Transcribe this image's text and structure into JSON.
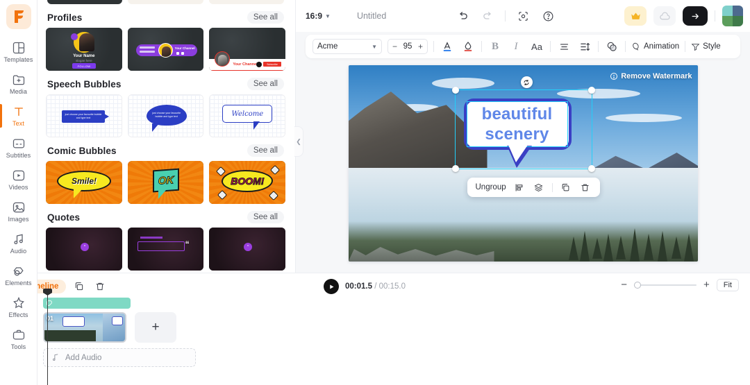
{
  "rail": {
    "logo": "flexclip-logo",
    "items": [
      {
        "label": "Templates",
        "icon": "templates-icon",
        "active": false
      },
      {
        "label": "Media",
        "icon": "media-icon",
        "active": false
      },
      {
        "label": "Text",
        "icon": "text-icon",
        "active": true
      },
      {
        "label": "Subtitles",
        "icon": "subtitles-icon",
        "active": false
      },
      {
        "label": "Videos",
        "icon": "videos-icon",
        "active": false
      },
      {
        "label": "Images",
        "icon": "images-icon",
        "active": false
      },
      {
        "label": "Audio",
        "icon": "audio-icon",
        "active": false
      },
      {
        "label": "Elements",
        "icon": "elements-icon",
        "active": false
      },
      {
        "label": "Effects",
        "icon": "effects-icon",
        "active": false
      },
      {
        "label": "Tools",
        "icon": "tools-icon",
        "active": false
      }
    ]
  },
  "panel": {
    "see_all": "See all",
    "sections": [
      {
        "title": "Profiles",
        "cards": [
          {
            "name": "Your Name",
            "sub": "slogan here",
            "button": "FOLLOW"
          },
          {
            "name": "Your Channel"
          },
          {
            "name": "Your Channel",
            "button": "Subscribe"
          }
        ]
      },
      {
        "title": "Speech Bubbles",
        "cards": [
          {
            "text": "just choose your favourite bubble and type text"
          },
          {
            "text": "just choose your favourite bubble and type text"
          },
          {
            "text": "Welcome"
          }
        ]
      },
      {
        "title": "Comic Bubbles",
        "cards": [
          {
            "text": "Smile!"
          },
          {
            "text": "OK"
          },
          {
            "text": "BOOM!"
          }
        ]
      },
      {
        "title": "Quotes",
        "cards": [
          {
            "text": "“"
          },
          {
            "text": "“"
          },
          {
            "text": "“"
          }
        ]
      }
    ],
    "collapse_icon": "chevron-left-icon"
  },
  "topbar": {
    "ratio": "16:9",
    "ratio_chevron": "chevron-down-icon",
    "doc_title": "Untitled",
    "undo_icon": "undo-icon",
    "redo_icon": "redo-icon",
    "record_icon": "record-icon",
    "help_icon": "help-circle-icon",
    "upgrade_icon": "crown-icon",
    "cloud_icon": "cloud-save-icon",
    "export_icon": "arrow-right-icon",
    "avatar": "user-avatar"
  },
  "text_toolbar": {
    "font": "Acme",
    "font_chevron": "chevron-down-icon",
    "size": "95",
    "minus": "−",
    "plus": "+",
    "color_icon": "font-color-icon",
    "highlight_icon": "text-highlight-icon",
    "bold": "B",
    "italic": "I",
    "case": "Aa",
    "align_icon": "text-align-icon",
    "spacing_icon": "line-spacing-icon",
    "opacity_icon": "opacity-icon",
    "animation_label": "Animation",
    "animation_icon": "animation-icon",
    "style_label": "Style",
    "style_icon": "style-icon"
  },
  "canvas": {
    "watermark": "Remove Watermark",
    "watermark_icon": "alert-circle-icon",
    "rotate_icon": "rotate-handle-icon",
    "bubble_text_line1": "beautiful",
    "bubble_text_line2": "scenery",
    "context_menu": {
      "ungroup": "Ungroup",
      "align_icon": "align-icon",
      "layer_icon": "layers-icon",
      "copy_icon": "duplicate-icon",
      "delete_icon": "trash-icon"
    }
  },
  "timeline": {
    "chip_label": "Timeline",
    "chip_icon": "timeline-icon",
    "copy_icon": "duplicate-icon",
    "delete_icon": "trash-icon",
    "clip_number": "01",
    "add_clip": "+",
    "add_audio": "Add Audio",
    "add_audio_icon": "music-note-icon",
    "sticker_icon": "sticker-icon"
  },
  "player": {
    "play_icon": "play-icon",
    "current_time": "00:01.5",
    "separator": "/",
    "total_time": "00:15.0",
    "zoom_out": "−",
    "zoom_in": "+",
    "fit_label": "Fit"
  },
  "colors": {
    "accent": "#f2720c",
    "selection": "#22cffa",
    "bubble_border": "#3a3fc4",
    "bubble_text": "#5f87e8",
    "sticker_track": "#7fd9c4"
  }
}
